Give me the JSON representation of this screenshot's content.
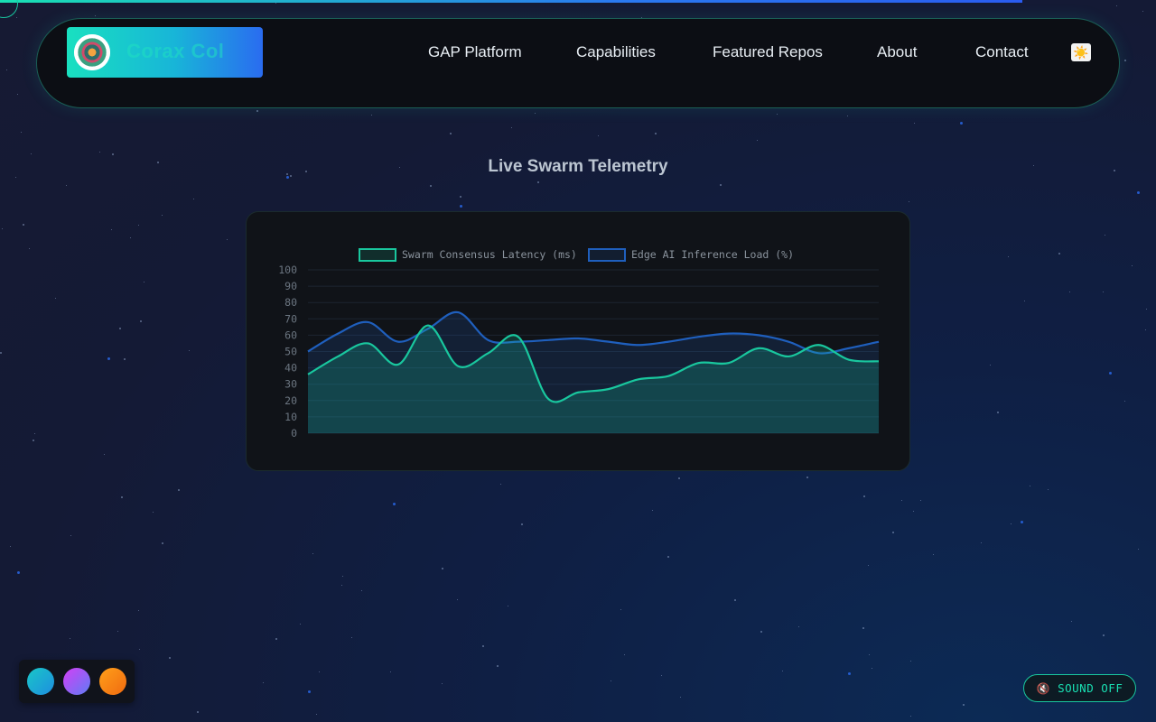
{
  "brand": {
    "name": "Corax Col",
    "logo_icon": "brand-logo-icon"
  },
  "nav": {
    "items": [
      {
        "label": "GAP Platform"
      },
      {
        "label": "Capabilities"
      },
      {
        "label": "Featured Repos"
      },
      {
        "label": "About"
      },
      {
        "label": "Contact"
      }
    ],
    "theme_toggle_icon": "☀️"
  },
  "section": {
    "title": "Live Swarm Telemetry"
  },
  "chart_data": {
    "type": "line",
    "area": true,
    "ylim": [
      0,
      100
    ],
    "yticks": [
      0,
      10,
      20,
      30,
      40,
      50,
      60,
      70,
      80,
      90,
      100
    ],
    "grid": true,
    "legend": "top",
    "series": [
      {
        "name": "Swarm Consensus Latency (ms)",
        "color": "#19c79e",
        "values": [
          36,
          47,
          55,
          42,
          66,
          41,
          49,
          59,
          21,
          25,
          27,
          33,
          35,
          43,
          43,
          52,
          47,
          54,
          45,
          44
        ]
      },
      {
        "name": "Edge AI Inference Load (%)",
        "color": "#1f5fbd",
        "values": [
          50,
          61,
          68,
          56,
          64,
          74,
          57,
          56,
          57,
          58,
          56,
          54,
          56,
          59,
          61,
          60,
          56,
          49,
          52,
          56
        ]
      }
    ]
  },
  "theme_swatches": [
    {
      "name": "teal",
      "colors": [
        "#19c7c7",
        "#1e8ee0"
      ]
    },
    {
      "name": "purple",
      "colors": [
        "#d43ef5",
        "#5f7df5"
      ]
    },
    {
      "name": "orange",
      "colors": [
        "#ffa01a",
        "#f06a10"
      ]
    }
  ],
  "sound": {
    "label": "SOUND OFF",
    "icon": "🔇"
  }
}
